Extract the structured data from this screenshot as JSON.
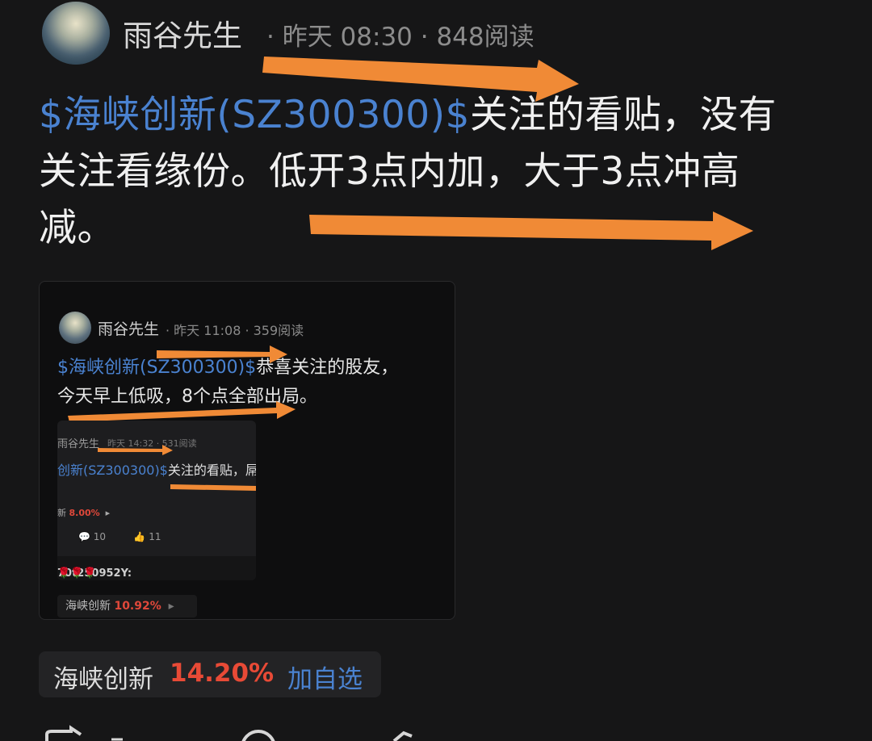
{
  "header": {
    "author": "雨谷先生",
    "meta": "· 昨天 08:30 · 848阅读"
  },
  "post": {
    "tag": "$海峡创新(SZ300300)$",
    "text": "关注的看贴，没有关注看缘份。低开3点内加，大于3点冲高减。"
  },
  "quoted": {
    "author": "雨谷先生",
    "meta": "· 昨天 11:08 · 359阅读",
    "tag": "$海峡创新(SZ300300)$",
    "text_line1": "恭喜关注的股友，",
    "text_line2": "今天早上低吸，8个点全部出局。",
    "inner": {
      "author": "雨谷先生",
      "meta": "昨天 14:32 · 531阅读",
      "tag": "创新(SZ300300)$",
      "text": "关注的看贴，屌",
      "stock_name": "新",
      "stock_pct": "8.00%",
      "comments": "10",
      "likes": "11",
      "comment_user": "70t250952Y:"
    },
    "stock_name": "海峡创新",
    "stock_pct": "10.92%"
  },
  "stock_pill": {
    "name": "海峡创新",
    "pct": "14.20%",
    "add": "加自选"
  },
  "colors": {
    "background": "#161617",
    "link": "#4a82d0",
    "up": "#e84a36",
    "arrow": "#f08a36"
  }
}
